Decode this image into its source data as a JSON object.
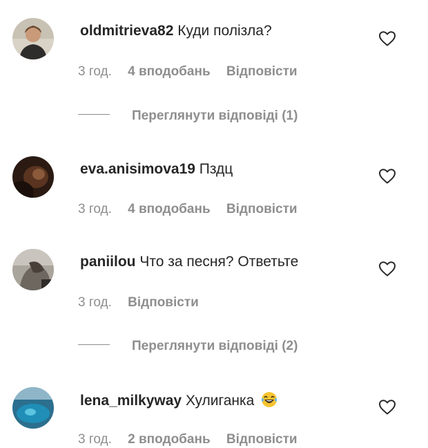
{
  "comments": [
    {
      "username": "oldmitrieva82",
      "text": "Куди полізла?",
      "time": "3 год.",
      "likes": "4 вподобань",
      "reply": "Відповісти",
      "view_replies": "Переглянути відповіді (1)"
    },
    {
      "username": "eva.anisimova19",
      "text": "Пздц",
      "time": "3 год.",
      "likes": "4 вподобань",
      "reply": "Відповісти"
    },
    {
      "username": "paniilou",
      "text": "Что за песня? Ответьте",
      "time": "3 год.",
      "reply": "Відповісти",
      "view_replies": "Переглянути відповіді (2)"
    },
    {
      "username": "lena_milkyway",
      "text": "Хулиганка",
      "time": "3 год.",
      "likes": "2 вподобань",
      "reply": "Відповісти"
    }
  ],
  "icons": {
    "like": "heart-outline-icon",
    "emoji": "laughing-tears-emoji"
  },
  "colors": {
    "primary_text": "#262626",
    "secondary_text": "#8e8e8e",
    "background": "#ffffff"
  }
}
